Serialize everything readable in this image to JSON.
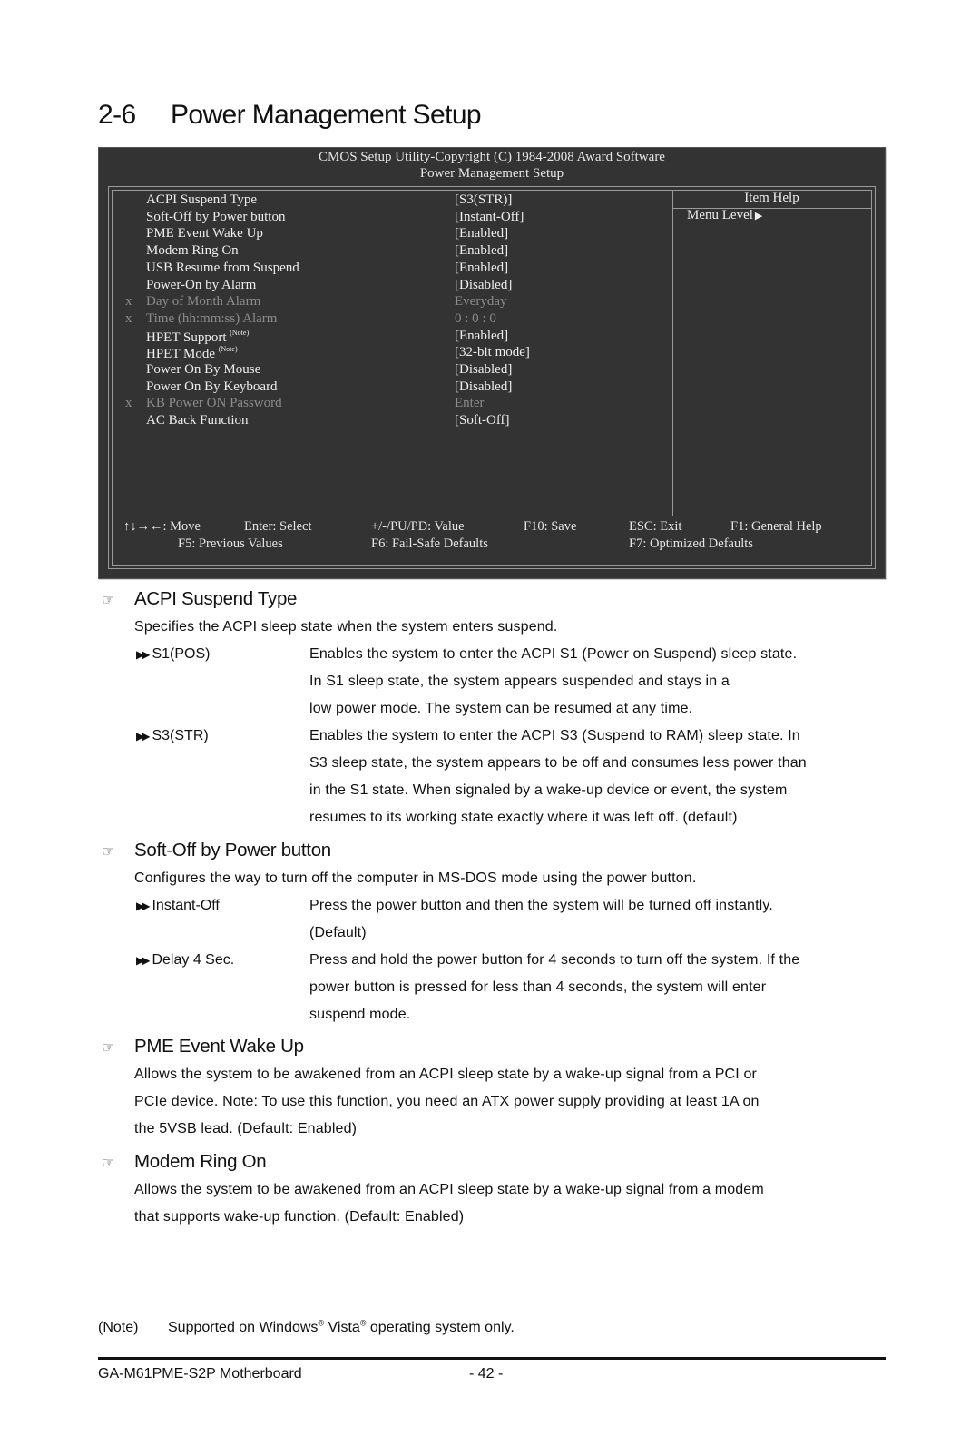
{
  "page": {
    "section_number": "2-6",
    "section_title": "Power Management Setup"
  },
  "bios": {
    "header_line1": "CMOS Setup Utility-Copyright (C) 1984-2008 Award Software",
    "header_line2": "Power Management Setup",
    "help_title": "Item Help",
    "menu_level": "Menu Level",
    "menu_level_icon": "right-triangle-icon",
    "items": [
      {
        "label": "ACPI Suspend Type",
        "value": "[S3(STR)]",
        "disabled": false,
        "mark": "",
        "note": ""
      },
      {
        "label": "Soft-Off by Power button",
        "value": "[Instant-Off]",
        "disabled": false,
        "mark": "",
        "note": ""
      },
      {
        "label": "PME Event Wake Up",
        "value": "[Enabled]",
        "disabled": false,
        "mark": "",
        "note": ""
      },
      {
        "label": "Modem Ring On",
        "value": "[Enabled]",
        "disabled": false,
        "mark": "",
        "note": ""
      },
      {
        "label": "USB Resume from Suspend",
        "value": "[Enabled]",
        "disabled": false,
        "mark": "",
        "note": ""
      },
      {
        "label": "Power-On by Alarm",
        "value": "[Disabled]",
        "disabled": false,
        "mark": "",
        "note": ""
      },
      {
        "label": "Day of Month Alarm",
        "value": "Everyday",
        "disabled": true,
        "mark": "x",
        "note": ""
      },
      {
        "label": "Time (hh:mm:ss) Alarm",
        "value": "0 : 0 : 0",
        "disabled": true,
        "mark": "x",
        "note": ""
      },
      {
        "label": "HPET Support",
        "value": "[Enabled]",
        "disabled": false,
        "mark": "",
        "note": "(Note)"
      },
      {
        "label": "HPET Mode",
        "value": "[32-bit mode]",
        "disabled": false,
        "mark": "",
        "note": "(Note)"
      },
      {
        "label": "Power On By Mouse",
        "value": "[Disabled]",
        "disabled": false,
        "mark": "",
        "note": ""
      },
      {
        "label": "Power On By Keyboard",
        "value": "[Disabled]",
        "disabled": false,
        "mark": "",
        "note": ""
      },
      {
        "label": "KB Power ON Password",
        "value": "Enter",
        "disabled": true,
        "mark": "x",
        "note": ""
      },
      {
        "label": "AC Back Function",
        "value": "[Soft-Off]",
        "disabled": false,
        "mark": "",
        "note": ""
      }
    ],
    "keys": {
      "move": "↑↓→←: Move",
      "select": "Enter: Select",
      "value": "+/-/PU/PD: Value",
      "save": "F10: Save",
      "exit": "ESC: Exit",
      "general_help": "F1: General Help",
      "previous": "F5: Previous Values",
      "failsafe": "F6: Fail-Safe Defaults",
      "optimized": "F7: Optimized Defaults"
    }
  },
  "sections": [
    {
      "title": "ACPI Suspend Type",
      "icon": "pointing-hand-icon",
      "intro": [
        "Specifies the ACPI sleep state when the system enters suspend."
      ],
      "options": [
        {
          "label": "S1(POS)",
          "desc": [
            "Enables the system to enter the ACPI S1 (Power on Suspend) sleep state.",
            "In S1 sleep state, the system appears suspended and stays in a",
            "low power mode. The system can be resumed at any time."
          ]
        },
        {
          "label": "S3(STR)",
          "desc": [
            "Enables the system to enter the ACPI S3 (Suspend to RAM) sleep state. In",
            "S3 sleep state, the system appears to be off and consumes less power than",
            "in the S1 state. When signaled by a wake-up device or event, the system",
            "resumes to its working state exactly where it was left off. (default)"
          ]
        }
      ]
    },
    {
      "title": "Soft-Off by Power button",
      "icon": "pointing-hand-icon",
      "intro": [
        "Configures the way to turn off the computer in MS-DOS mode using the power button."
      ],
      "options": [
        {
          "label": "Instant-Off",
          "desc": [
            "Press the power button and then the system will be turned off instantly.",
            "(Default)"
          ]
        },
        {
          "label": "Delay 4 Sec.",
          "desc": [
            "Press and hold the power button for 4 seconds to turn off the system. If the",
            "power button is pressed for less than 4 seconds, the system will enter",
            "suspend mode."
          ]
        }
      ]
    },
    {
      "title": "PME Event Wake Up",
      "icon": "pointing-hand-icon",
      "intro": [
        "Allows the system to be awakened from an ACPI sleep state by a wake-up signal from a PCI or",
        "PCIe device. Note: To use this function, you need an ATX power supply providing at least 1A on",
        "the 5VSB lead. (Default: Enabled)"
      ],
      "options": []
    },
    {
      "title": "Modem Ring On",
      "icon": "pointing-hand-icon",
      "intro": [
        "Allows the system to be awakened from an ACPI sleep state by a wake-up signal from a modem",
        "that supports wake-up function. (Default: Enabled)"
      ],
      "options": []
    }
  ],
  "note": {
    "tag": "(Note)",
    "text_before": "Supported on Windows",
    "reg1": "®",
    "text_middle": " Vista",
    "reg2": "®",
    "text_after": " operating system only."
  },
  "footer": {
    "product": "GA-M61PME-S2P Motherboard",
    "page_number": "- 42 -"
  }
}
